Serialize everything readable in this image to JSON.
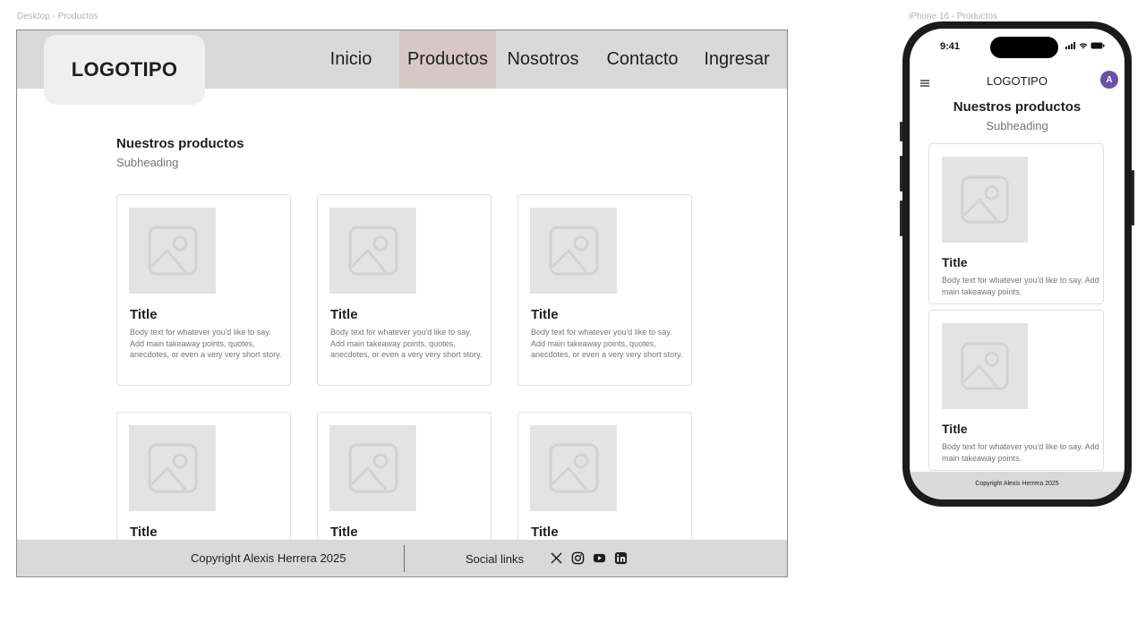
{
  "frames": {
    "desktop_label": "Desktop - Productos",
    "mobile_label": "iPhone 16 - Productos"
  },
  "desktop": {
    "logo": "LOGOTIPO",
    "nav": [
      {
        "label": "Inicio",
        "active": false
      },
      {
        "label": "Productos",
        "active": true
      },
      {
        "label": "Nosotros",
        "active": false
      },
      {
        "label": "Contacto",
        "active": false
      },
      {
        "label": "Ingresar",
        "active": false
      }
    ],
    "heading": "Nuestros productos",
    "subheading": "Subheading",
    "cards": [
      {
        "title": "Title",
        "body": "Body text for whatever you'd like to say. Add main takeaway points, quotes, anecdotes, or even a very very short story."
      },
      {
        "title": "Title",
        "body": "Body text for whatever you'd like to say. Add main takeaway points, quotes, anecdotes, or even a very very short story."
      },
      {
        "title": "Title",
        "body": "Body text for whatever you'd like to say. Add main takeaway points, quotes, anecdotes, or even a very very short story."
      },
      {
        "title": "Title",
        "body": ""
      },
      {
        "title": "Title",
        "body": ""
      },
      {
        "title": "Title",
        "body": ""
      }
    ],
    "footer": {
      "copyright": "Copyright Alexis Herrera 2025",
      "social_label": "Social links",
      "social_icons": [
        "x-icon",
        "instagram-icon",
        "youtube-icon",
        "linkedin-icon"
      ]
    }
  },
  "mobile": {
    "status_time": "9:41",
    "logo": "LOGOTIPO",
    "avatar_initial": "A",
    "heading": "Nuestros productos",
    "subheading": "Subheading",
    "cards": [
      {
        "title": "Title",
        "body": "Body text for whatever you'd like to say. Add main takeaway points."
      },
      {
        "title": "Title",
        "body": "Body text for whatever you'd like to say. Add main takeaway points."
      }
    ],
    "footer": "Copyright Alexis Herrera 2025"
  },
  "colors": {
    "header_bg": "#d9d9d9",
    "active_nav_bg": "#d6c8c8",
    "avatar_bg": "#6c4fa8",
    "placeholder_bg": "#e3e3e3"
  }
}
